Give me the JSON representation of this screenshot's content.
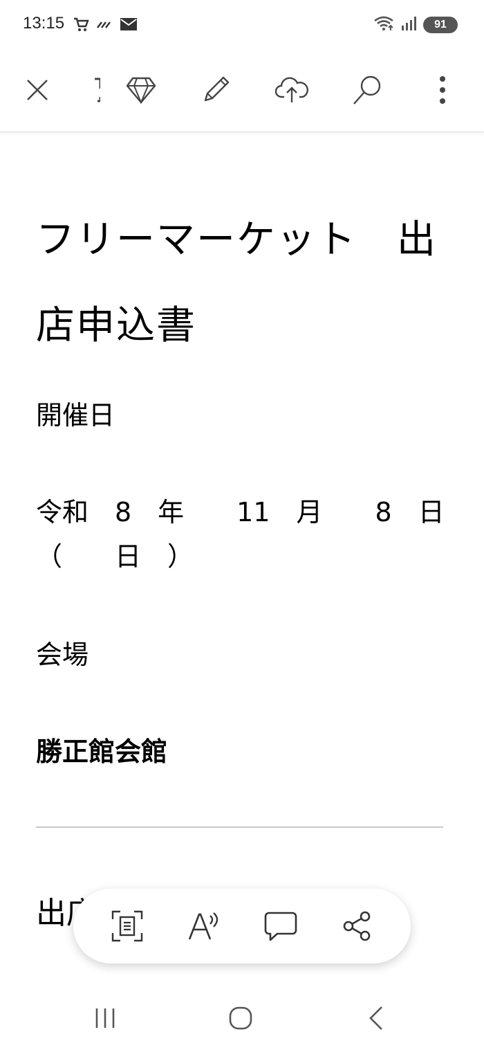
{
  "status_bar": {
    "time": "13:15",
    "left_icons": [
      "cart-icon",
      "pattern-icon",
      "mail-icon"
    ],
    "right_icons": [
      "wifi-icon",
      "signal-icon"
    ],
    "battery": "91"
  },
  "toolbar": {
    "buttons": [
      "close-icon",
      "crop-icon",
      "premium-icon",
      "edit-icon",
      "cloud-upload-icon",
      "search-icon",
      "more-icon"
    ]
  },
  "document": {
    "title_line1": "フリーマーケット　出",
    "title_line2": "店申込書",
    "label_date": "開催日",
    "date_line1": "令和　8　年　　11　月　　8　日",
    "date_line2": "（　　日　）",
    "label_venue": "会場",
    "venue": "勝正館会館",
    "partial_heading": "出店"
  },
  "action_bar": {
    "buttons": [
      "scan-text-icon",
      "read-aloud-icon",
      "comment-icon",
      "share-icon"
    ]
  },
  "nav_bar": {
    "buttons": [
      "recent-apps-icon",
      "home-icon",
      "back-icon"
    ]
  }
}
